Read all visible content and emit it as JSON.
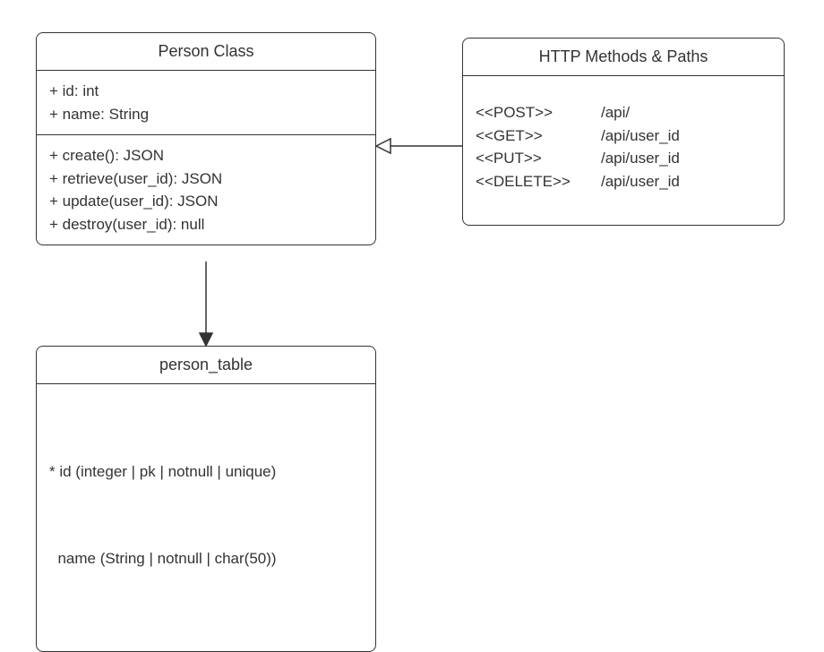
{
  "person_class": {
    "title": "Person Class",
    "attributes": [
      "+ id: int",
      "+ name: String"
    ],
    "methods": [
      "+ create(): JSON",
      "+ retrieve(user_id): JSON",
      "+ update(user_id): JSON",
      "+ destroy(user_id): null"
    ]
  },
  "http_methods": {
    "title": "HTTP Methods & Paths",
    "rows": [
      {
        "method": "<<POST>>",
        "path": "/api/"
      },
      {
        "method": "<<GET>>",
        "path": "/api/user_id"
      },
      {
        "method": "<<PUT>>",
        "path": "/api/user_id"
      },
      {
        "method": "<<DELETE>>",
        "path": "/api/user_id"
      }
    ]
  },
  "person_table": {
    "title": "person_table",
    "columns": [
      "* id (integer | pk | notnull | unique)",
      "  name (String | notnull | char(50))"
    ]
  },
  "connectors": {
    "http_to_person": {
      "from": "http_methods",
      "to": "person_class",
      "arrow": "open"
    },
    "person_to_table": {
      "from": "person_class",
      "to": "person_table",
      "arrow": "filled"
    }
  },
  "colors": {
    "stroke": "#333333",
    "bg": "#ffffff"
  }
}
